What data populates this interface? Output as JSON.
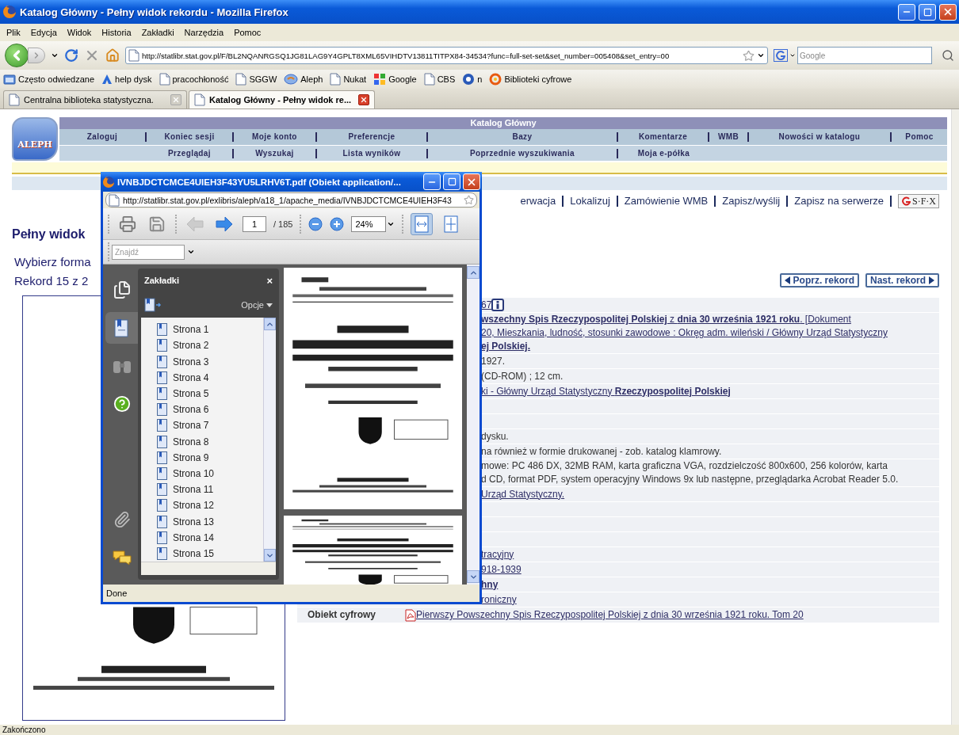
{
  "window": {
    "title": "Katalog Główny - Pełny widok rekordu - Mozilla Firefox"
  },
  "menu": [
    "Plik",
    "Edycja",
    "Widok",
    "Historia",
    "Zakładki",
    "Narzędzia",
    "Pomoc"
  ],
  "navigation": {
    "url": "http://statlibr.stat.gov.pl/F/BL2NQANRGSQ1JG81LAG9Y4GPLT8XML65VIHDTV13811TITPX84-34534?func=full-set-set&set_number=005408&set_entry=00",
    "search_placeholder": "Google"
  },
  "bookmarks": [
    {
      "label": "Często odwiedzane",
      "kind": "folder"
    },
    {
      "label": "help dysk",
      "kind": "arrow"
    },
    {
      "label": "pracochłoność",
      "kind": "page"
    },
    {
      "label": "SGGW",
      "kind": "page"
    },
    {
      "label": "Aleph",
      "kind": "aleph"
    },
    {
      "label": "Nukat",
      "kind": "page"
    },
    {
      "label": "Google",
      "kind": "google"
    },
    {
      "label": "CBS",
      "kind": "page"
    },
    {
      "label": "n",
      "kind": "globe"
    },
    {
      "label": "Biblioteki cyfrowe",
      "kind": "ring"
    }
  ],
  "tabs": [
    {
      "label": "Centralna biblioteka statystyczna.",
      "selected": false
    },
    {
      "label": "Katalog Główny - Pełny widok re...",
      "selected": true
    }
  ],
  "catalog": {
    "logo_text": "ALEPH",
    "title": "Katalog Główny",
    "menu_rows": [
      [
        "Zaloguj",
        "Koniec sesji",
        "Moje konto",
        "Preferencje",
        "Bazy",
        "Komentarze",
        "WMB",
        "Nowości w katalogu",
        "Pomoc"
      ],
      [
        "Przeglądaj",
        "Wyszukaj",
        "Lista wyników",
        "Poprzednie wyszukiwania",
        "Moja e-półka"
      ]
    ],
    "actions": [
      "erwacja",
      "Lokalizuj",
      "Zamówienie WMB",
      "Zapisz/wyślij",
      "Zapisz na serwerze"
    ],
    "sfx": "S·F·X",
    "heading": "Pełny widok",
    "format_label": "Wybierz forma",
    "record_counter": "Rekord 15 z 2",
    "prev_button": "Poprz. rekord",
    "next_button": "Nast. rekord",
    "rows": [
      {
        "kind": "id",
        "lines": [
          "67"
        ]
      },
      {
        "kind": "link",
        "lines": [
          "**wszechny Spis Rzeczypospolitej Polskiej** z **dnia 30 września 1921 roku**. [Dokument",
          "20, Mieszkania, ludność, stosunki zawodowe : Okręg adm. wileński / Główny Urząd Statystyczny",
          "**ej Polskiej.**"
        ]
      },
      {
        "kind": "text",
        "lines": [
          "1927."
        ]
      },
      {
        "kind": "text",
        "lines": [
          "(CD-ROM) ; 12 cm."
        ]
      },
      {
        "kind": "link",
        "lines": [
          "ki - Główny Urząd Statystyczny **Rzeczypospolitej Polskiej**"
        ]
      },
      {
        "kind": "empty",
        "lines": []
      },
      {
        "kind": "empty",
        "lines": []
      },
      {
        "kind": "text",
        "lines": [
          "dysku."
        ]
      },
      {
        "kind": "text",
        "lines": [
          "na również w formie drukowanej - zob. katalog klamrowy."
        ]
      },
      {
        "kind": "text",
        "lines": [
          "mowe: PC 486 DX, 32MB RAM, karta graficzna VGA, rozdzielczość 800x600, 256 kolorów, karta",
          "d CD, format PDF, system operacyjny Windows 9x lub następne, przeglądarka Acrobat Reader 5.0."
        ]
      },
      {
        "kind": "link",
        "lines": [
          "Urząd Statystyczny."
        ]
      },
      {
        "kind": "empty",
        "lines": []
      },
      {
        "kind": "empty",
        "lines": []
      },
      {
        "kind": "empty",
        "lines": []
      },
      {
        "kind": "link",
        "lines": [
          "tracyjny"
        ]
      },
      {
        "kind": "link",
        "lines": [
          "918-1939"
        ]
      },
      {
        "kind": "link",
        "lines": [
          "**hny**"
        ]
      },
      {
        "kind": "link",
        "lines": [
          "roniczny"
        ]
      }
    ],
    "digital_object": {
      "label": "Obiekt cyfrowy",
      "link": "Pierwszy Powszechny Spis Rzeczypospolitej Polskiej z dnia 30 września 1921 roku. Tom 20"
    }
  },
  "pdf_window": {
    "title": "IVNBJDCTCMCE4UIEH3F43YU5LRHV6T.pdf (Obiekt application/...",
    "url": "http://statlibr.stat.gov.pl/exlibris/aleph/a18_1/apache_media/IVNBJDCTCMCE4UIEH3F43",
    "page": "1",
    "page_count": "/ 185",
    "zoom": "24%",
    "find_placeholder": "Znajdź",
    "nav_buttons": [
      {
        "kind": "prev",
        "disabled": true
      },
      {
        "kind": "next",
        "disabled": false
      }
    ],
    "view_modes": [
      {
        "kind": "fit-width",
        "selected": true
      },
      {
        "kind": "fit-page",
        "selected": false
      }
    ],
    "side_tools": [
      {
        "kind": "pages",
        "selected": false
      },
      {
        "kind": "bookmarks",
        "selected": true
      },
      {
        "kind": "search",
        "selected": false
      },
      {
        "kind": "help",
        "selected": false
      }
    ],
    "side_tools_bottom": [
      {
        "kind": "attachments",
        "selected": false
      },
      {
        "kind": "comments",
        "selected": false
      }
    ],
    "panel_title": "Zakładki",
    "panel_close": "×",
    "options": "Opcje",
    "bookmarks": [
      "Strona 1",
      "Strona 2",
      "Strona 3",
      "Strona 4",
      "Strona 5",
      "Strona 6",
      "Strona 7",
      "Strona 8",
      "Strona 9",
      "Strona 10",
      "Strona 11",
      "Strona 12",
      "Strona 13",
      "Strona 14",
      "Strona 15"
    ],
    "status": "Done"
  },
  "status_bar": "Zakończono"
}
